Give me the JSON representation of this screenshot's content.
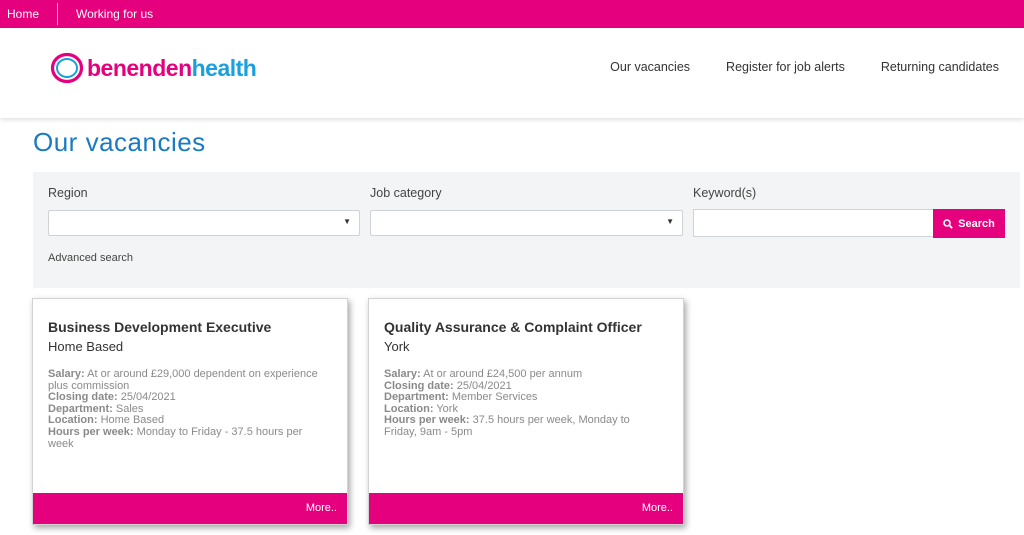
{
  "topnav": {
    "home": "Home",
    "working": "Working for us"
  },
  "brand": {
    "name_part1": "benenden",
    "name_part2": "health",
    "colors": {
      "pink": "#e5007e",
      "blue": "#1aa0dc"
    }
  },
  "mainnav": [
    {
      "label": "Our vacancies"
    },
    {
      "label": "Register for job alerts"
    },
    {
      "label": "Returning candidates"
    }
  ],
  "page": {
    "title": "Our vacancies"
  },
  "search": {
    "region_label": "Region",
    "category_label": "Job category",
    "keyword_label": "Keyword(s)",
    "keyword_value": "",
    "search_label": "Search",
    "advanced_label": "Advanced search"
  },
  "vacancies": [
    {
      "title": "Business Development Executive",
      "location_heading": "Home Based",
      "salary_label": "Salary:",
      "salary": "At or around £29,000 dependent on experience plus commission",
      "closing_label": "Closing date:",
      "closing": "25/04/2021",
      "dept_label": "Department:",
      "dept": "Sales",
      "location_label": "Location:",
      "location": "Home Based",
      "hours_label": "Hours per week:",
      "hours": "Monday to Friday - 37.5 hours per week",
      "more": "More.."
    },
    {
      "title": "Quality Assurance & Complaint Officer",
      "location_heading": "York",
      "salary_label": "Salary:",
      "salary": "At or around £24,500 per annum",
      "closing_label": "Closing date:",
      "closing": "25/04/2021",
      "dept_label": "Department:",
      "dept": "Member Services",
      "location_label": "Location:",
      "location": "York",
      "hours_label": "Hours per week:",
      "hours": "37.5 hours per week, Monday to Friday, 9am - 5pm",
      "more": "More.."
    }
  ]
}
